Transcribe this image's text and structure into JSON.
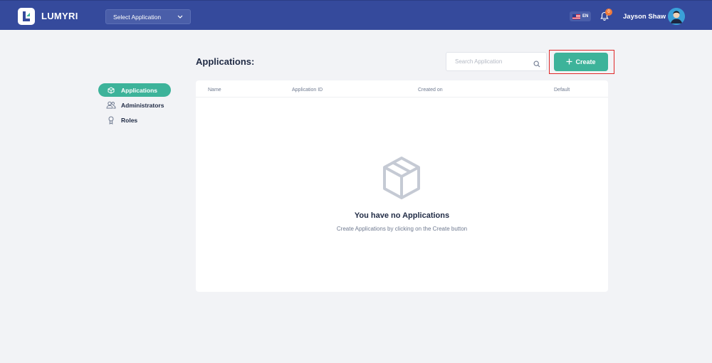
{
  "header": {
    "brand": "LUMYRI",
    "app_select_label": "Select Application",
    "language": "EN",
    "notification_count": "0",
    "user_name": "Jayson Shaw"
  },
  "sidebar": {
    "items": [
      {
        "label": "Applications",
        "icon": "cube-icon",
        "active": true
      },
      {
        "label": "Administrators",
        "icon": "users-icon",
        "active": false
      },
      {
        "label": "Roles",
        "icon": "badge-icon",
        "active": false
      }
    ]
  },
  "main": {
    "title": "Applications:",
    "search_placeholder": "Search Application",
    "create_label": "Create",
    "table": {
      "columns": [
        "Name",
        "Application ID",
        "Created on",
        "Default"
      ]
    },
    "empty_state": {
      "title": "You have no Applications",
      "subtitle": "Create Applications by clicking on the Create button"
    }
  },
  "colors": {
    "header_bg": "#354a9c",
    "accent": "#3db39a",
    "highlight": "#e02828"
  }
}
